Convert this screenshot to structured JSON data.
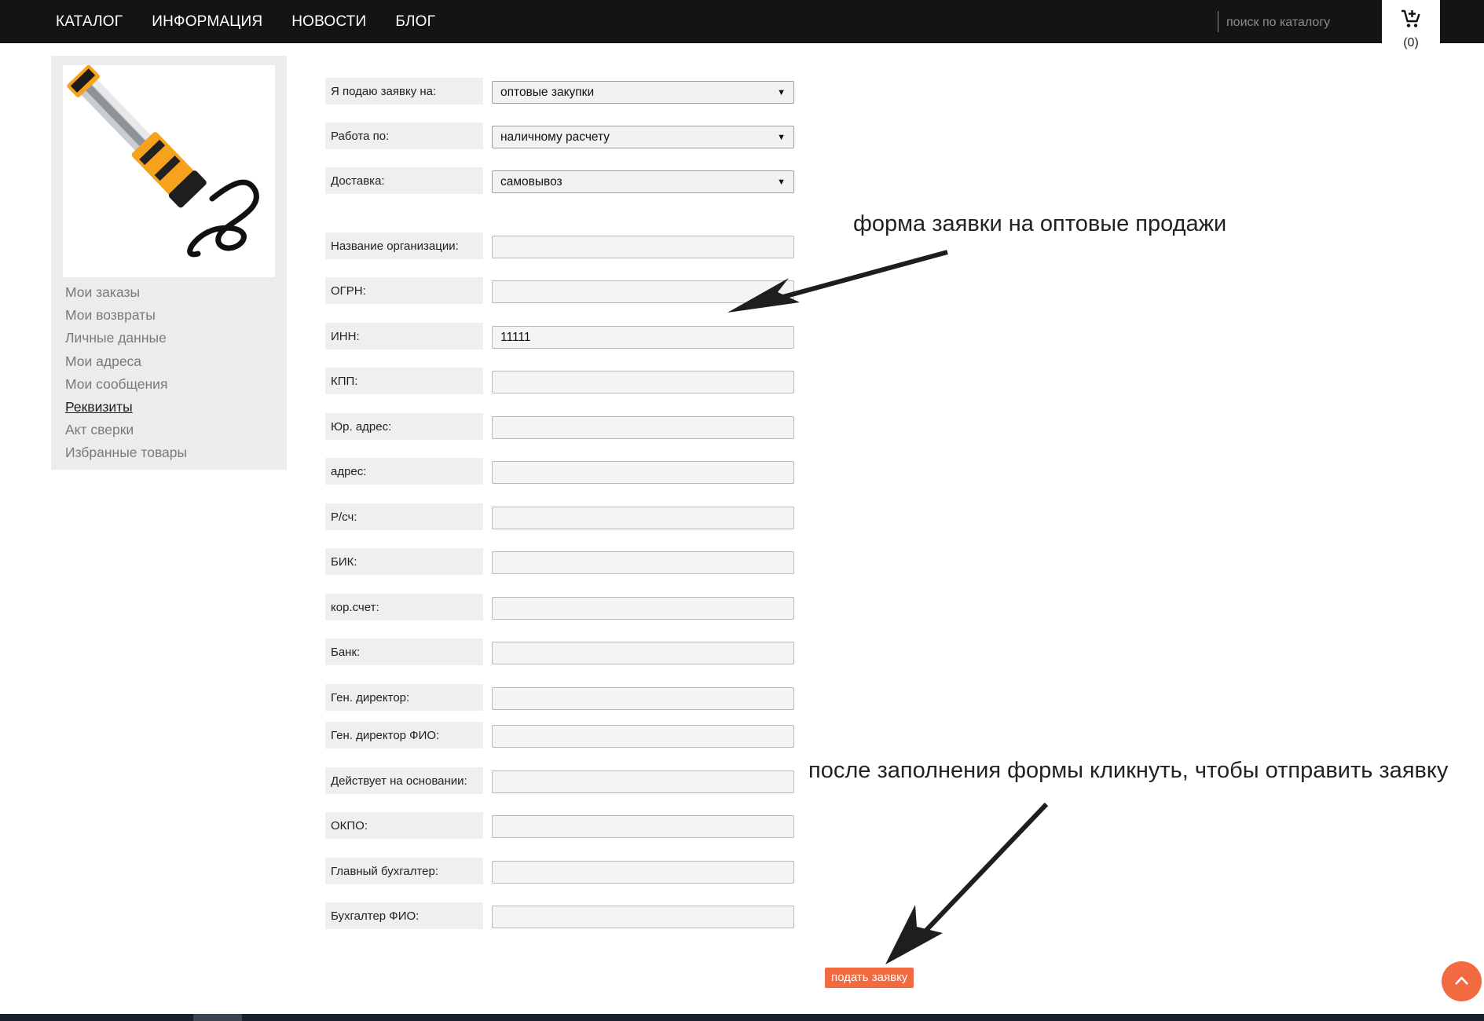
{
  "header": {
    "nav": [
      "КАТАЛОГ",
      "ИНФОРМАЦИЯ",
      "НОВОСТИ",
      "БЛОГ"
    ],
    "search_placeholder": "поиск по каталогу",
    "cart_icon": "cart-plus-icon",
    "cart_count": "(0)"
  },
  "sidebar": {
    "product_image": "yellow-led-work-lamp",
    "menu": [
      "Мои заказы",
      "Мои возвраты",
      "Личные данные",
      "Мои адреса",
      "Мои сообщения",
      "Реквизиты",
      "Акт сверки",
      "Избранные товары"
    ],
    "active_item": "Реквизиты"
  },
  "form": {
    "selects": [
      {
        "label": "Я подаю заявку на:",
        "value": "оптовые закупки"
      },
      {
        "label": "Работа по:",
        "value": "наличному расчету"
      },
      {
        "label": "Доставка:",
        "value": "самовывоз"
      }
    ],
    "fields": [
      {
        "label": "Название организации:",
        "value": ""
      },
      {
        "label": "ОГРН:",
        "value": ""
      },
      {
        "label": "ИНН:",
        "value": "11111"
      },
      {
        "label": "КПП:",
        "value": ""
      },
      {
        "label": "Юр. адрес:",
        "value": ""
      },
      {
        "label": "адрес:",
        "value": ""
      },
      {
        "label": "Р/сч:",
        "value": ""
      },
      {
        "label": "БИК:",
        "value": ""
      },
      {
        "label": "кор.счет:",
        "value": ""
      },
      {
        "label": "Банк:",
        "value": ""
      },
      {
        "label": "Ген. директор:",
        "value": ""
      },
      {
        "label": "Ген. директор ФИО:",
        "value": ""
      },
      {
        "label": "Действует на основании:",
        "value": ""
      },
      {
        "label": "ОКПО:",
        "value": ""
      },
      {
        "label": "Главный бухгалтер:",
        "value": ""
      },
      {
        "label": "Бухгалтер ФИО:",
        "value": ""
      }
    ],
    "submit_label": "подать заявку"
  },
  "annotations": {
    "form_note": "форма заявки на оптовые продажи",
    "submit_note": "после заполнения формы кликнуть, чтобы отправить заявку"
  },
  "scroll_top_icon": "chevron-up-icon",
  "colors": {
    "header_bg": "#141414",
    "accent": "#f26a40",
    "sidebar_bg": "#ececec",
    "footer_bg": "#17202b"
  }
}
